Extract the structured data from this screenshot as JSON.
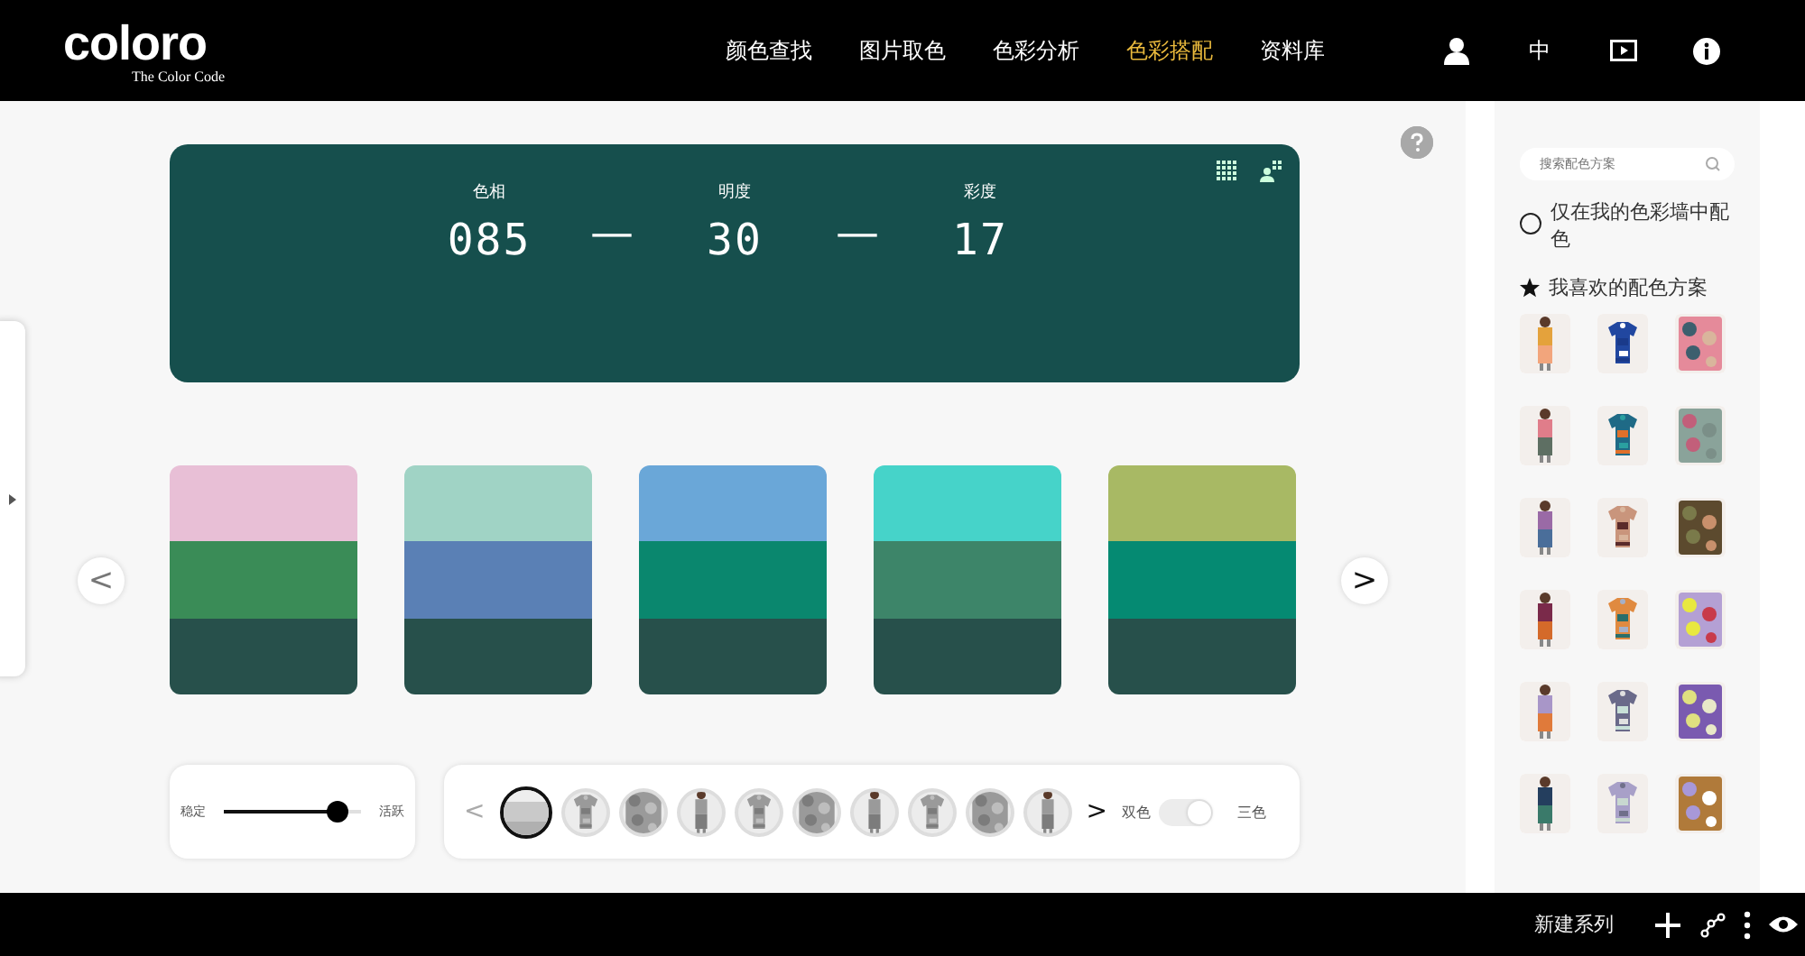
{
  "header": {
    "logo": "coloro",
    "tagline": "The Color Code",
    "nav": [
      {
        "label": "颜色查找",
        "selected": false
      },
      {
        "label": "图片取色",
        "selected": false
      },
      {
        "label": "色彩分析",
        "selected": false
      },
      {
        "label": "色彩搭配",
        "selected": true
      },
      {
        "label": "资料库",
        "selected": false
      }
    ],
    "language": "中"
  },
  "color_code": {
    "fields": [
      {
        "label": "色相",
        "value": "085"
      },
      {
        "label": "明度",
        "value": "30"
      },
      {
        "label": "彩度",
        "value": "17"
      }
    ],
    "separator": "—"
  },
  "palettes": [
    {
      "bands": [
        {
          "color": "#e8bfd6"
        },
        {
          "color": "#3a8c57"
        },
        {
          "color": "#27504b"
        }
      ]
    },
    {
      "bands": [
        {
          "color": "#a0d3c5"
        },
        {
          "color": "#5a80b5"
        },
        {
          "color": "#27504b"
        }
      ]
    },
    {
      "bands": [
        {
          "color": "#6aa7d8"
        },
        {
          "color": "#0a876e"
        },
        {
          "color": "#27504b"
        }
      ]
    },
    {
      "bands": [
        {
          "color": "#46d3c9"
        },
        {
          "color": "#3d8569"
        },
        {
          "color": "#27504b"
        }
      ]
    },
    {
      "bands": [
        {
          "color": "#a8b964"
        },
        {
          "color": "#058a72"
        },
        {
          "color": "#27504b"
        }
      ]
    }
  ],
  "prev_label": "<",
  "next_label": ">",
  "mood": {
    "min_label": "稳定",
    "max_label": "活跃",
    "level": 0.83
  },
  "styles": {
    "prev_label": "<",
    "next_label": ">",
    "items": [
      {
        "kind": "swatch",
        "selected": true
      },
      {
        "kind": "picture",
        "selected": false
      },
      {
        "kind": "picture",
        "selected": false
      },
      {
        "kind": "picture",
        "selected": false
      },
      {
        "kind": "picture",
        "selected": false
      },
      {
        "kind": "picture",
        "selected": false
      },
      {
        "kind": "picture",
        "selected": false
      },
      {
        "kind": "picture",
        "selected": false
      },
      {
        "kind": "picture",
        "selected": false
      },
      {
        "kind": "picture",
        "selected": false
      }
    ],
    "toggle": {
      "left_label": "双色",
      "right_label": "三色",
      "on": true
    }
  },
  "sidebar": {
    "search": {
      "placeholder": "搜索配色方案"
    },
    "wall_only": {
      "label": "仅在我的色彩墙中配色",
      "checked": false
    },
    "favorites_title": "我喜欢的配色方案",
    "favorites": [
      {
        "kind": "picture"
      },
      {
        "kind": "picture"
      },
      {
        "kind": "picture"
      },
      {
        "kind": "picture"
      },
      {
        "kind": "picture"
      },
      {
        "kind": "picture"
      },
      {
        "kind": "picture"
      },
      {
        "kind": "picture"
      },
      {
        "kind": "picture"
      },
      {
        "kind": "picture"
      },
      {
        "kind": "picture"
      },
      {
        "kind": "picture"
      },
      {
        "kind": "picture"
      },
      {
        "kind": "picture"
      },
      {
        "kind": "picture"
      },
      {
        "kind": "picture"
      },
      {
        "kind": "picture"
      },
      {
        "kind": "picture"
      }
    ]
  },
  "footer": {
    "new_series": "新建系列"
  }
}
